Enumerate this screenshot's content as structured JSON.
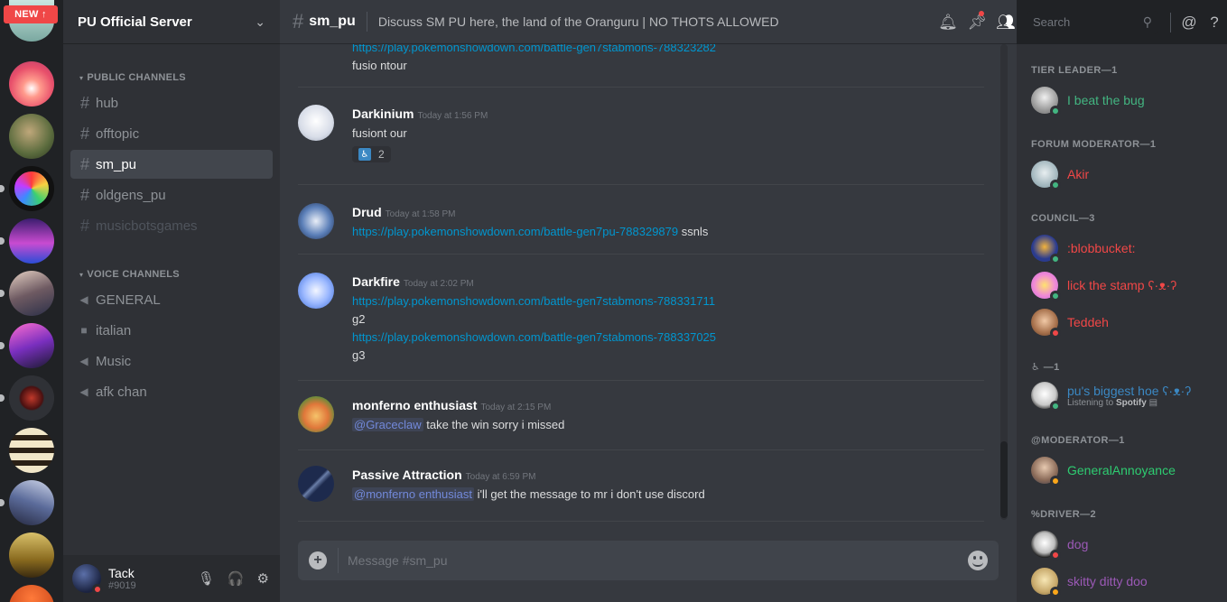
{
  "guilds": {
    "new_badge": "NEW ↑"
  },
  "server": {
    "name": "PU Official Server"
  },
  "categories": {
    "public": "PUBLIC CHANNELS",
    "voice": "VOICE CHANNELS"
  },
  "text_channels": [
    "hub",
    "offtopic",
    "sm_pu",
    "oldgens_pu",
    "musicbotsgames"
  ],
  "voice_channels": [
    "GENERAL",
    "italian",
    "Music",
    "afk chan"
  ],
  "user": {
    "name": "Tack",
    "tag": "#9019"
  },
  "channel": {
    "name": "sm_pu",
    "topic": "Discuss SM PU here, the land of the Oranguru | NO THOTS ALLOWED"
  },
  "search": {
    "placeholder": "Search"
  },
  "messages": [
    {
      "lines": [
        {
          "type": "link",
          "text": "https://play.pokemonshowdown.com/battle-gen7stabmons-788323282"
        },
        {
          "type": "text",
          "text": "fusio ntour"
        }
      ]
    },
    {
      "author": "Darkinium",
      "time": "Today at 1:56 PM",
      "lines": [
        {
          "type": "text",
          "text": "fusiont our"
        }
      ],
      "reaction": {
        "emoji": "♿",
        "count": "2"
      }
    },
    {
      "author": "Drud",
      "time": "Today at 1:58 PM",
      "lines": [
        {
          "type": "link",
          "text": "https://play.pokemonshowdown.com/battle-gen7pu-788329879",
          "after": " ssnls"
        }
      ]
    },
    {
      "author": "Darkfire",
      "time": "Today at 2:02 PM",
      "lines": [
        {
          "type": "link",
          "text": "https://play.pokemonshowdown.com/battle-gen7stabmons-788331711"
        },
        {
          "type": "text",
          "text": "g2"
        },
        {
          "type": "link",
          "text": "https://play.pokemonshowdown.com/battle-gen7stabmons-788337025"
        },
        {
          "type": "text",
          "text": "g3"
        }
      ]
    },
    {
      "author": "monferno enthusiast",
      "time": "Today at 2:15 PM",
      "lines": [
        {
          "type": "mention",
          "mention": "@Graceclaw",
          "text": " take the win sorry i missed"
        }
      ]
    },
    {
      "author": "Passive Attraction",
      "time": "Today at 6:59 PM",
      "lines": [
        {
          "type": "mention",
          "mention": "@monferno enthusiast",
          "text": " i'll get the message to mr i don't use discord"
        }
      ]
    }
  ],
  "composer": {
    "placeholder": "Message #sm_pu"
  },
  "member_groups": [
    {
      "role": "TIER LEADER—1",
      "members": [
        {
          "name": "I beat the bug",
          "color": "#43b581",
          "status": "online"
        }
      ]
    },
    {
      "role": "FORUM MODERATOR—1",
      "members": [
        {
          "name": "Akir",
          "color": "#f04747",
          "status": "online"
        }
      ]
    },
    {
      "role": "COUNCIL—3",
      "members": [
        {
          "name": ":blobbucket:",
          "color": "#f04747",
          "status": "online"
        },
        {
          "name": "lick the stamp ʕ·ᴥ·ʔ",
          "color": "#f04747",
          "status": "online"
        },
        {
          "name": "Teddeh",
          "color": "#f04747",
          "status": "dnd"
        }
      ]
    },
    {
      "role": "♿ —1",
      "members": [
        {
          "name": "pu's biggest hoe ʕ·ᴥ·ʔ",
          "color": "#3b88c3",
          "status": "online",
          "activity_prefix": "Listening to ",
          "activity": "Spotify"
        }
      ]
    },
    {
      "role": "@MODERATOR—1",
      "members": [
        {
          "name": "GeneralAnnoyance",
          "color": "#2ecc71",
          "status": "idle"
        }
      ]
    },
    {
      "role": "%DRIVER—2",
      "members": [
        {
          "name": "dog",
          "color": "#9b59b6",
          "status": "dnd"
        },
        {
          "name": "skitty ditty doo",
          "color": "#9b59b6",
          "status": "idle"
        }
      ]
    }
  ]
}
